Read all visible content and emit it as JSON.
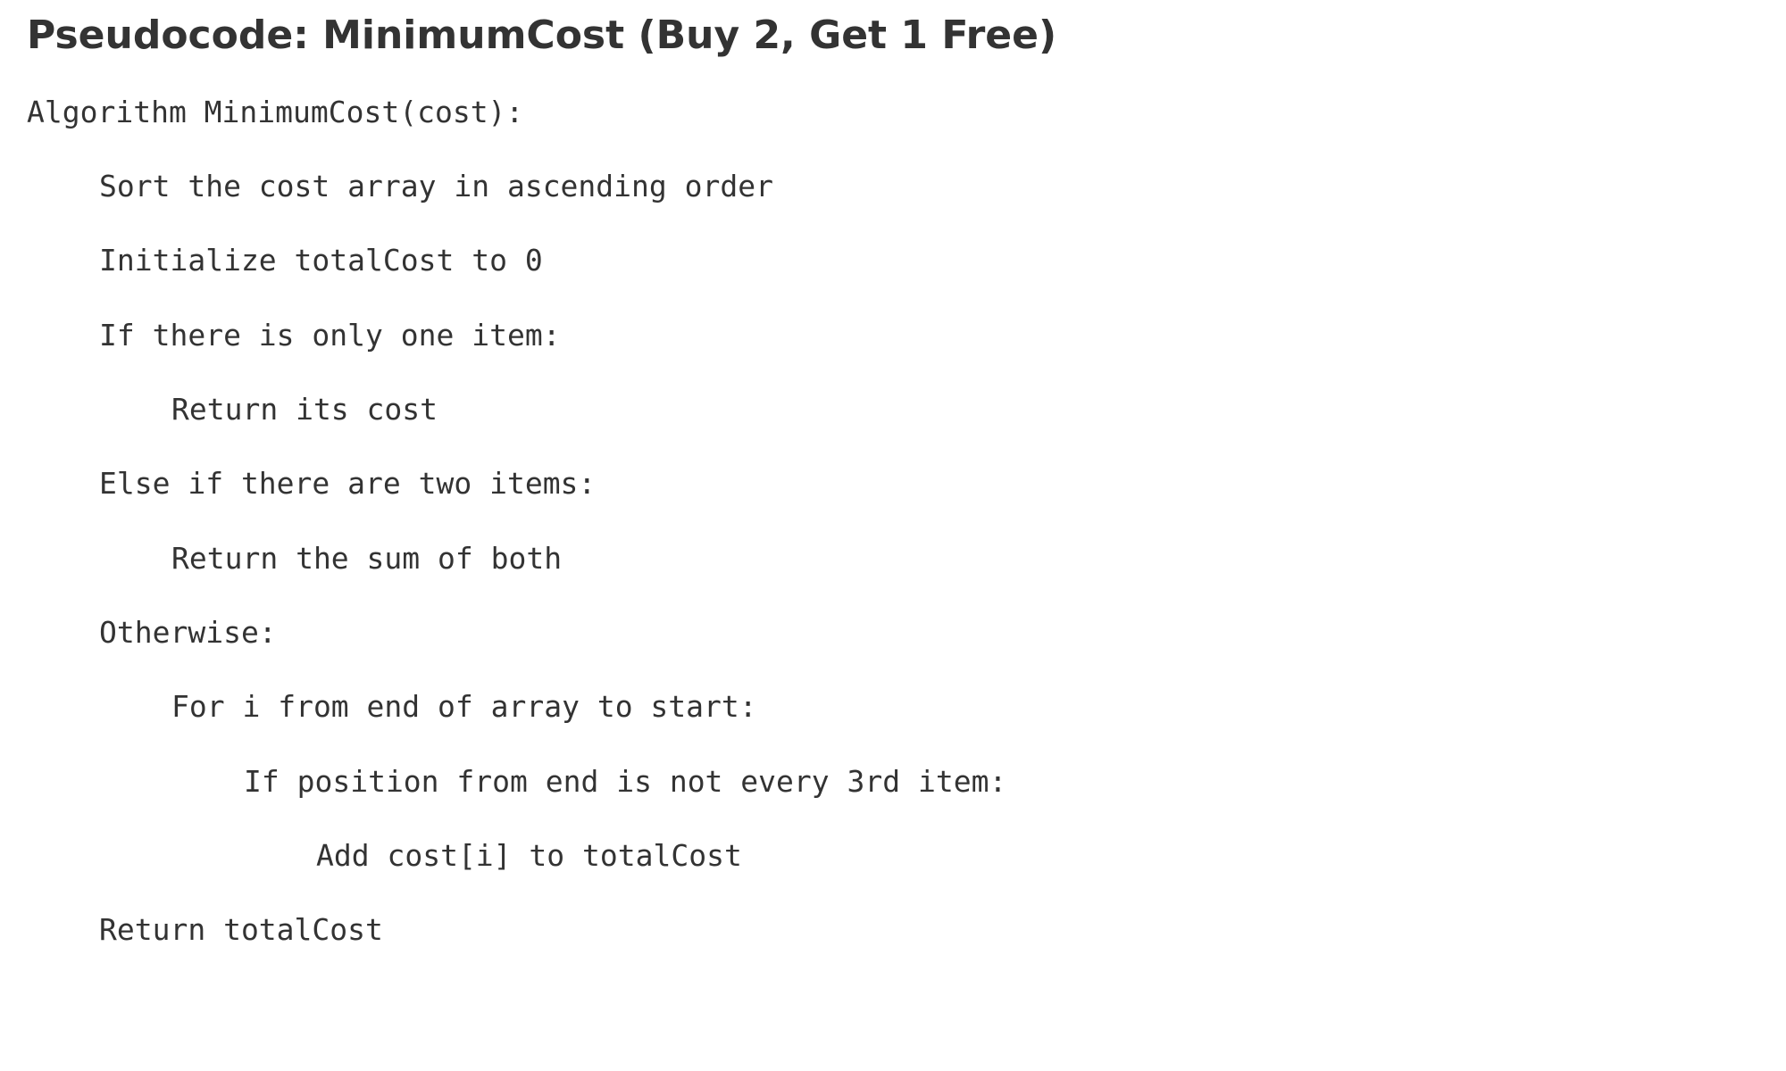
{
  "title": "Pseudocode: MinimumCost (Buy 2, Get 1 Free)",
  "lines": [
    {
      "text": "Algorithm MinimumCost(cost):",
      "indent": 0
    },
    {
      "text": "Sort the cost array in ascending order",
      "indent": 1
    },
    {
      "text": "Initialize totalCost to 0",
      "indent": 1
    },
    {
      "text": "If there is only one item:",
      "indent": 1
    },
    {
      "text": "Return its cost",
      "indent": 2
    },
    {
      "text": "Else if there are two items:",
      "indent": 1
    },
    {
      "text": "Return the sum of both",
      "indent": 2
    },
    {
      "text": "Otherwise:",
      "indent": 1
    },
    {
      "text": "For i from end of array to start:",
      "indent": 2
    },
    {
      "text": "If position from end is not every 3rd item:",
      "indent": 3
    },
    {
      "text": "Add cost[i] to totalCost",
      "indent": 4
    },
    {
      "text": "Return totalCost",
      "indent": 1
    }
  ],
  "colors": {
    "text": "#333333",
    "background": "#ffffff"
  }
}
